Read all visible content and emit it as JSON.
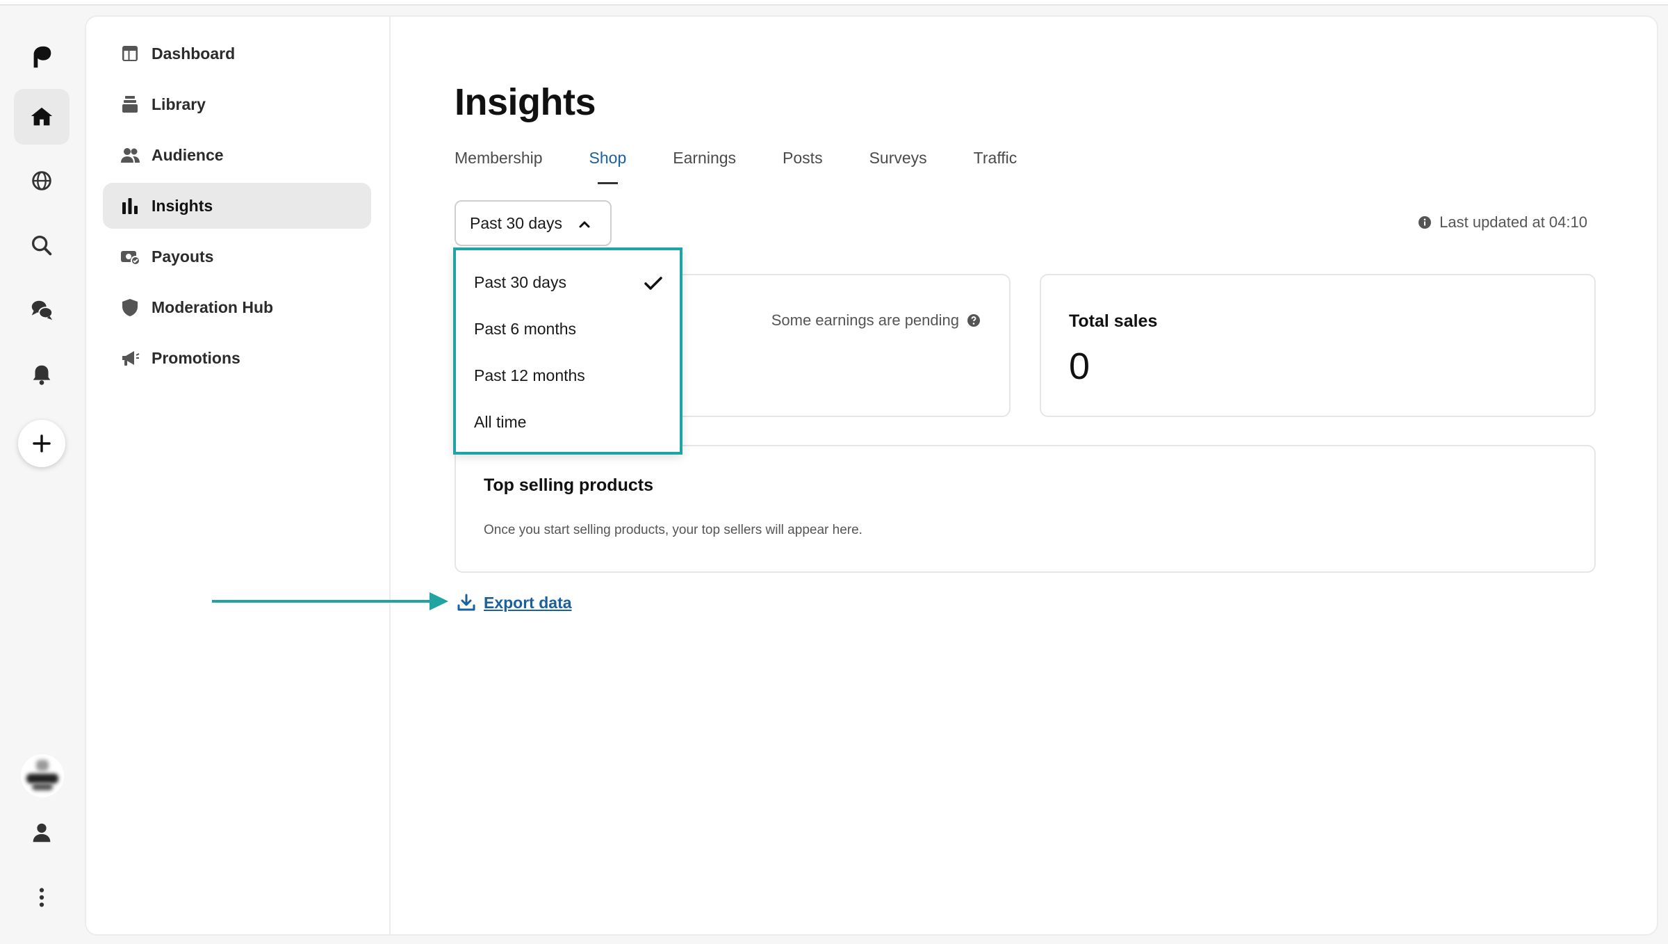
{
  "rail": {
    "icons": [
      "logo-icon",
      "home-icon",
      "globe-icon",
      "search-icon",
      "chat-icon",
      "bell-icon",
      "plus-icon",
      "user-icon",
      "more-icon"
    ]
  },
  "nav": {
    "items": [
      {
        "label": "Dashboard",
        "icon": "dashboard-icon"
      },
      {
        "label": "Library",
        "icon": "library-icon"
      },
      {
        "label": "Audience",
        "icon": "audience-icon"
      },
      {
        "label": "Insights",
        "icon": "insights-icon",
        "active": true
      },
      {
        "label": "Payouts",
        "icon": "payouts-icon"
      },
      {
        "label": "Moderation Hub",
        "icon": "shield-icon"
      },
      {
        "label": "Promotions",
        "icon": "megaphone-icon"
      }
    ]
  },
  "page": {
    "title": "Insights",
    "tabs": [
      {
        "label": "Membership"
      },
      {
        "label": "Shop",
        "active": true
      },
      {
        "label": "Earnings"
      },
      {
        "label": "Posts"
      },
      {
        "label": "Surveys"
      },
      {
        "label": "Traffic"
      }
    ],
    "range_selected": "Past 30 days",
    "last_updated": "Last updated at 04:10"
  },
  "dropdown": {
    "options": [
      {
        "label": "Past 30 days",
        "selected": true
      },
      {
        "label": "Past 6 months"
      },
      {
        "label": "Past 12 months"
      },
      {
        "label": "All time"
      }
    ]
  },
  "earnings_panel": {
    "pending_text": "Some earnings are pending"
  },
  "sales_panel": {
    "title": "Total sales",
    "value": "0"
  },
  "top_products": {
    "title": "Top selling products",
    "description": "Once you start selling products, your top sellers will appear here."
  },
  "export": {
    "label": "Export data"
  },
  "colors": {
    "accent": "#1a5f9e",
    "highlight": "#1fa3a3",
    "active_bg": "#e9e9e9"
  }
}
